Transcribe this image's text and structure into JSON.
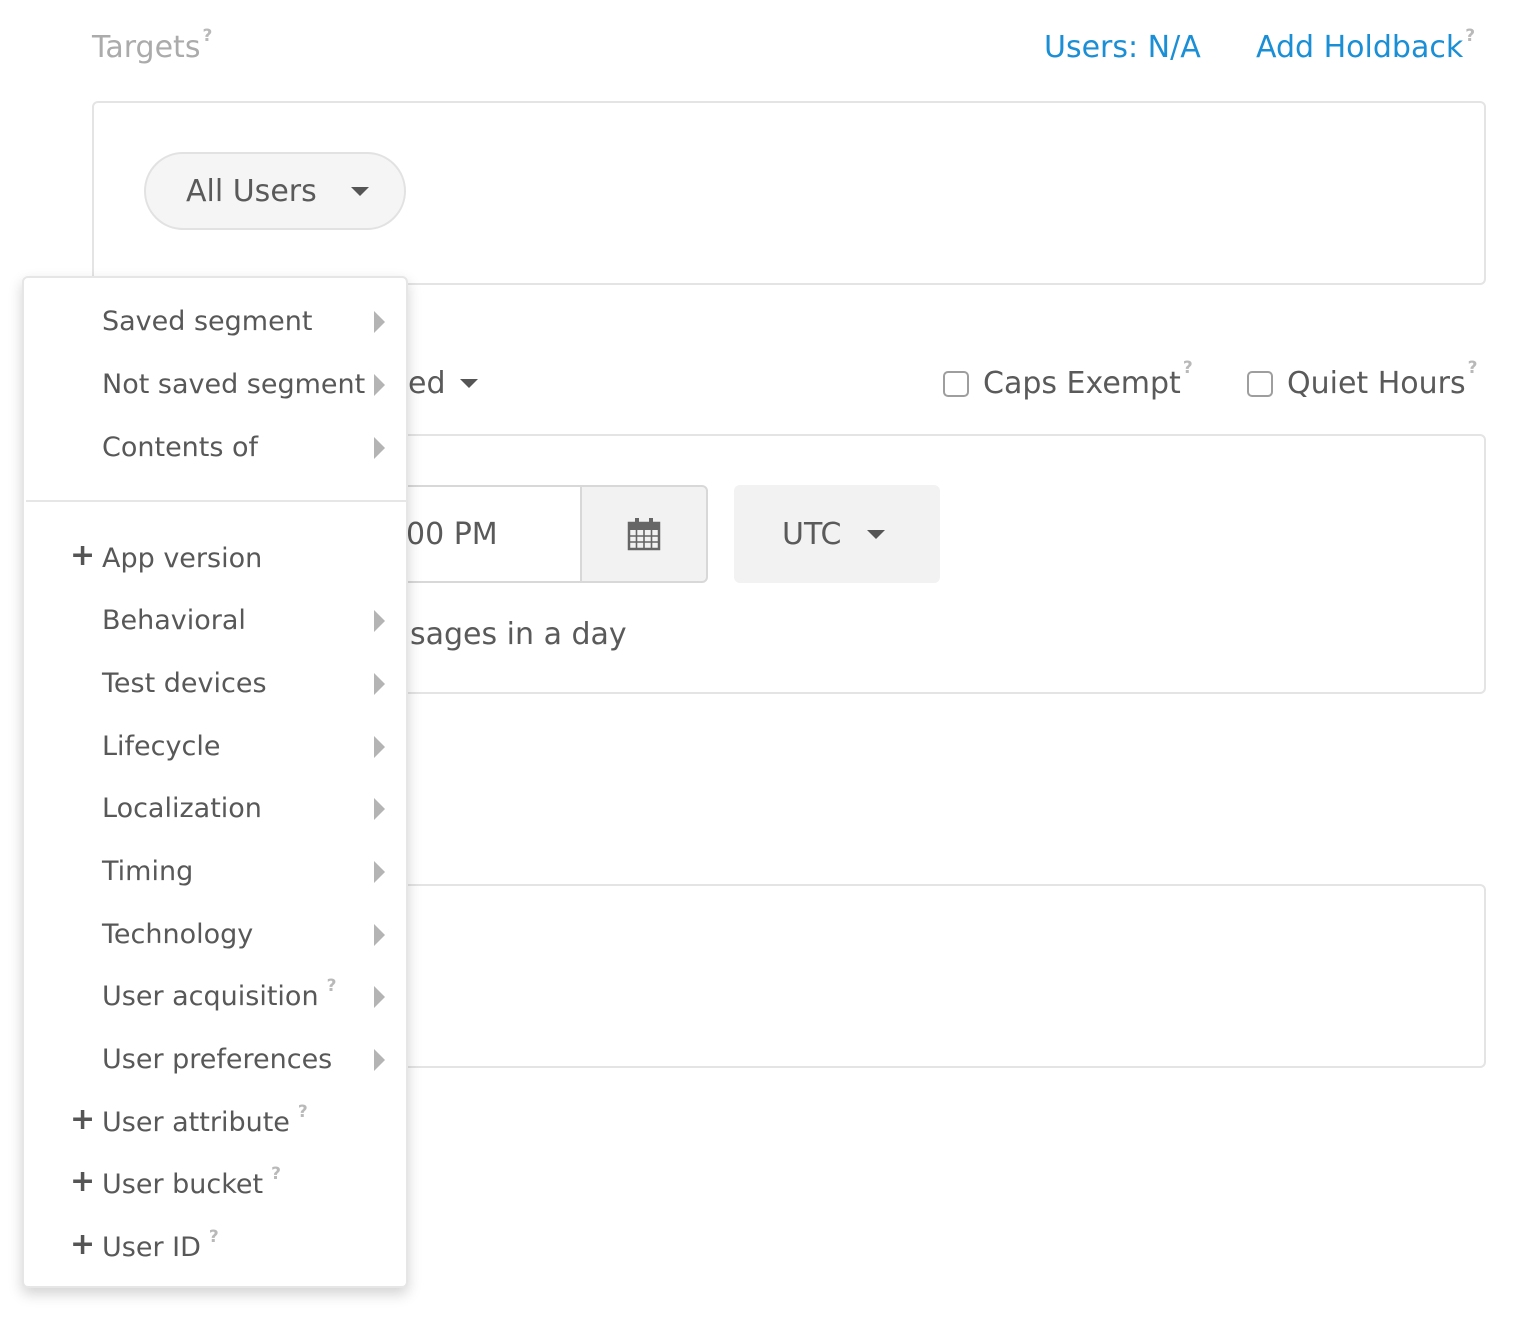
{
  "header": {
    "targets_label": "Targets",
    "help": "?",
    "users_link": "Users: N/A",
    "add_holdback_link": "Add Holdback"
  },
  "targets": {
    "segment_select": "All Users"
  },
  "schedule": {
    "partial_select_text": "ed",
    "caps_exempt_label": "Caps Exempt",
    "quiet_hours_label": "Quiet Hours",
    "time_value": "00 PM",
    "timezone": "UTC",
    "messages_text": "sages in a day"
  },
  "menu": {
    "items": [
      {
        "label": "Saved segment"
      },
      {
        "label": "Not saved segment"
      },
      {
        "label": "Contents of"
      },
      {
        "label": "App version"
      },
      {
        "label": "Behavioral"
      },
      {
        "label": "Test devices"
      },
      {
        "label": "Lifecycle"
      },
      {
        "label": "Localization"
      },
      {
        "label": "Timing"
      },
      {
        "label": "Technology"
      },
      {
        "label": "User acquisition"
      },
      {
        "label": "User preferences"
      },
      {
        "label": "User attribute"
      },
      {
        "label": "User bucket"
      },
      {
        "label": "User ID"
      }
    ],
    "plus_icon": "plus-icon",
    "submenu_icon": "caret-right-icon"
  },
  "colors": {
    "link": "#1a8fd6",
    "text": "#5a5a5a",
    "muted": "#ababab",
    "border": "#e4e4e4"
  }
}
